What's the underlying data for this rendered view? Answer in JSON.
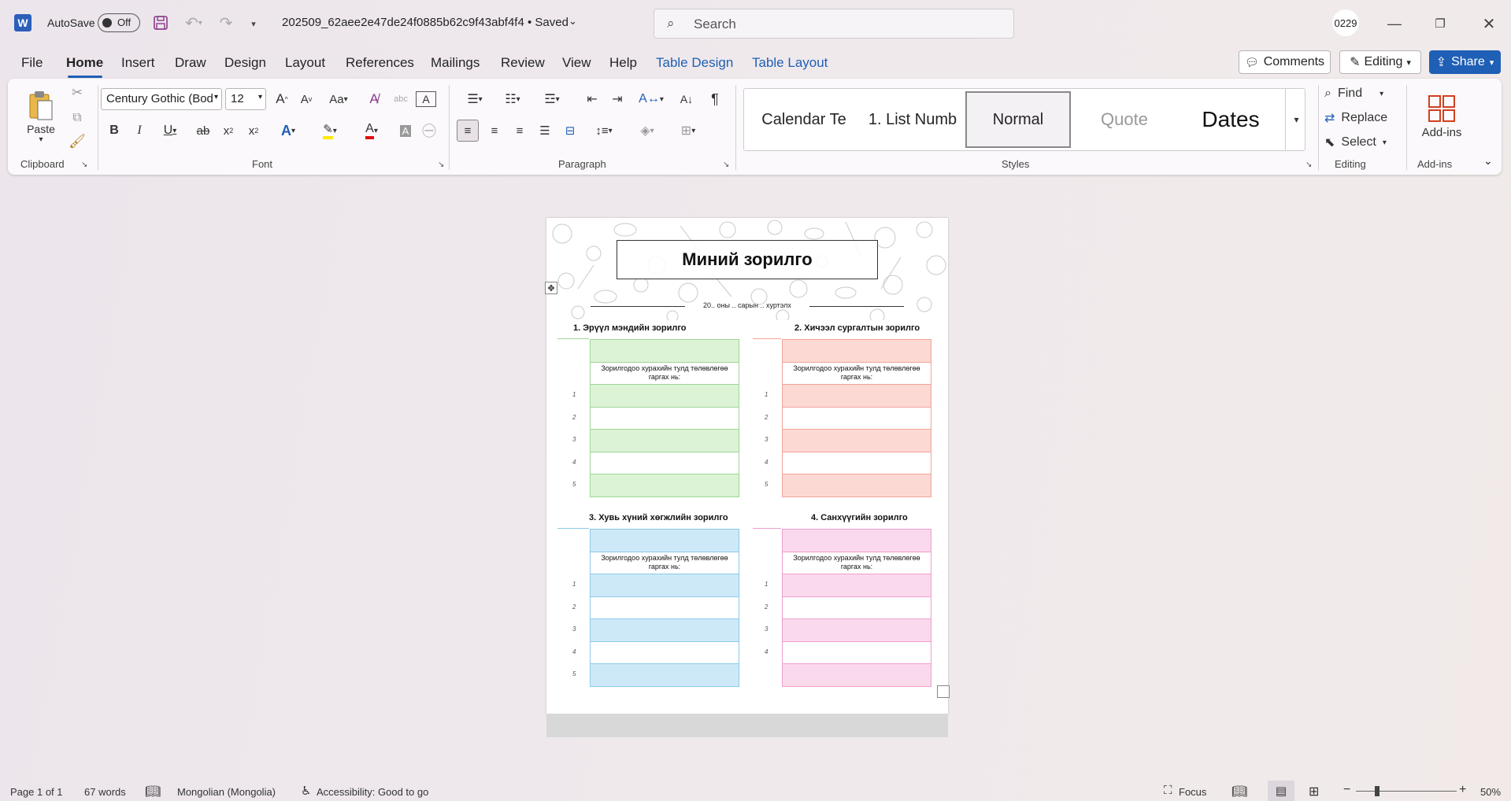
{
  "titlebar": {
    "autosave_label": "AutoSave",
    "autosave_state": "Off",
    "doc_title": "202509_62aee2e47de24f0885b62c9f43abf4f4 • Saved",
    "search_placeholder": "Search",
    "user_badge": "0229"
  },
  "tabs": [
    "File",
    "Home",
    "Insert",
    "Draw",
    "Design",
    "Layout",
    "References",
    "Mailings",
    "Review",
    "View",
    "Help",
    "Table Design",
    "Table Layout"
  ],
  "right_actions": {
    "comments": "Comments",
    "editing": "Editing",
    "share": "Share"
  },
  "ribbon": {
    "clipboard": {
      "paste": "Paste",
      "label": "Clipboard"
    },
    "font": {
      "family": "Century Gothic (Bod",
      "size": "12",
      "label": "Font",
      "case": "Aa"
    },
    "paragraph": {
      "label": "Paragraph"
    },
    "styles": {
      "items": [
        "Calendar Te",
        "1.  List Numb",
        "Normal",
        "Quote",
        "Dates"
      ],
      "label": "Styles"
    },
    "editing": {
      "find": "Find",
      "replace": "Replace",
      "select": "Select",
      "label": "Editing"
    },
    "addins": {
      "button": "Add-ins",
      "label": "Add-ins"
    }
  },
  "document": {
    "title": "Миний зорилго",
    "subtitle": "20.. оны .. сарын .. хуртэлх",
    "plan_text": "Зорилгодоо хурахийн тулд төлөвлөгөө гаргах нь:",
    "sections": [
      {
        "heading": "1.  Эрүүл мэндийн зорилго",
        "numbers": [
          "1",
          "2",
          "3",
          "4",
          "5"
        ]
      },
      {
        "heading": "2.  Хичээл сургалтын зорилго",
        "numbers": [
          "1",
          "2",
          "3",
          "4",
          "5"
        ]
      },
      {
        "heading": "3.  Хувь хүний хөгжлийн зорилго",
        "numbers": [
          "1",
          "2",
          "3",
          "4",
          "5"
        ]
      },
      {
        "heading": "4.  Санхүүгийн зорилго",
        "numbers": [
          "1",
          "2",
          "3",
          "4"
        ]
      }
    ],
    "colors": {
      "green": "#dcf3d6",
      "green_border": "#9fd596",
      "red": "#fdd9d4",
      "red_border": "#f2a49a",
      "blue": "#cde9f8",
      "blue_border": "#8dc9ea",
      "pink": "#fbd9ec",
      "pink_border": "#ef9fcb"
    }
  },
  "status": {
    "page": "Page 1 of 1",
    "words": "67 words",
    "language": "Mongolian (Mongolia)",
    "accessibility": "Accessibility: Good to go",
    "focus": "Focus",
    "zoom": "50%"
  }
}
